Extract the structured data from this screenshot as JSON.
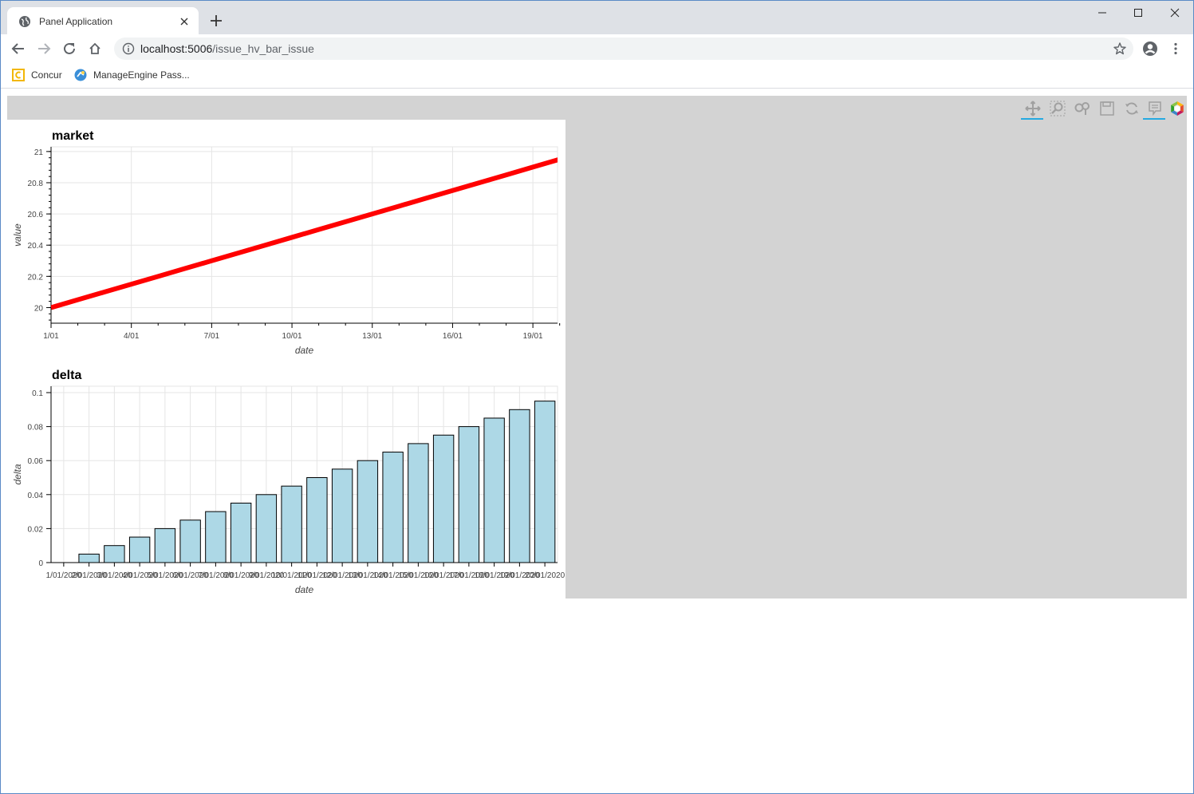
{
  "browser": {
    "tab_title": "Panel Application",
    "url_host": "localhost:5006",
    "url_path": "/issue_hv_bar_issue",
    "bookmarks": [
      {
        "label": "Concur",
        "icon": "concur-icon"
      },
      {
        "label": "ManageEngine Pass...",
        "icon": "manageengine-icon"
      }
    ]
  },
  "bokeh_toolbar": {
    "tools": [
      "pan-tool-icon",
      "box-zoom-tool-icon",
      "wheel-zoom-tool-icon",
      "save-tool-icon",
      "reset-tool-icon",
      "hover-tool-icon",
      "bokeh-logo-icon"
    ],
    "active": [
      "pan-tool-icon",
      "hover-tool-icon"
    ]
  },
  "colors": {
    "line": "#ff0000",
    "bar_fill": "#add8e6",
    "bar_stroke": "#000000",
    "panel_bg": "#d3d3d3"
  },
  "chart_data": [
    {
      "type": "line",
      "title": "market",
      "xlabel": "date",
      "ylabel": "value",
      "x": [
        "1/01",
        "2/01",
        "3/01",
        "4/01",
        "5/01",
        "6/01",
        "7/01",
        "8/01",
        "9/01",
        "10/01",
        "11/01",
        "12/01",
        "13/01",
        "14/01",
        "15/01",
        "16/01",
        "17/01",
        "18/01",
        "19/01",
        "20/01"
      ],
      "series": [
        {
          "values": [
            20.0,
            20.05,
            20.1,
            20.15,
            20.2,
            20.25,
            20.3,
            20.35,
            20.4,
            20.45,
            20.5,
            20.55,
            20.6,
            20.65,
            20.7,
            20.75,
            20.8,
            20.85,
            20.9,
            20.95
          ]
        }
      ],
      "xticks": [
        "1/01",
        "4/01",
        "7/01",
        "10/01",
        "13/01",
        "16/01",
        "19/01"
      ],
      "yticks": [
        "20",
        "20.2",
        "20.4",
        "20.6",
        "20.8",
        "21"
      ],
      "ylim": [
        19.9,
        21.03
      ],
      "grid": true
    },
    {
      "type": "bar",
      "title": "delta",
      "xlabel": "date",
      "ylabel": "delta",
      "categories": [
        "1/01/2020",
        "2/01/2020",
        "3/01/2020",
        "4/01/2020",
        "5/01/2020",
        "6/01/2020",
        "7/01/2020",
        "8/01/2020",
        "9/01/2020",
        "10/01/2020",
        "11/01/2020",
        "12/01/2020",
        "13/01/2020",
        "14/01/2020",
        "15/01/2020",
        "16/01/2020",
        "17/01/2020",
        "18/01/2020",
        "19/01/2020",
        "20/01/2020"
      ],
      "values": [
        0,
        0.005,
        0.01,
        0.015,
        0.02,
        0.025,
        0.03,
        0.035,
        0.04,
        0.045,
        0.05,
        0.055,
        0.06,
        0.065,
        0.07,
        0.075,
        0.08,
        0.085,
        0.09,
        0.095
      ],
      "yticks": [
        "0",
        "0.02",
        "0.04",
        "0.06",
        "0.08",
        "0.1"
      ],
      "ylim": [
        0,
        0.1
      ],
      "grid": true
    }
  ]
}
